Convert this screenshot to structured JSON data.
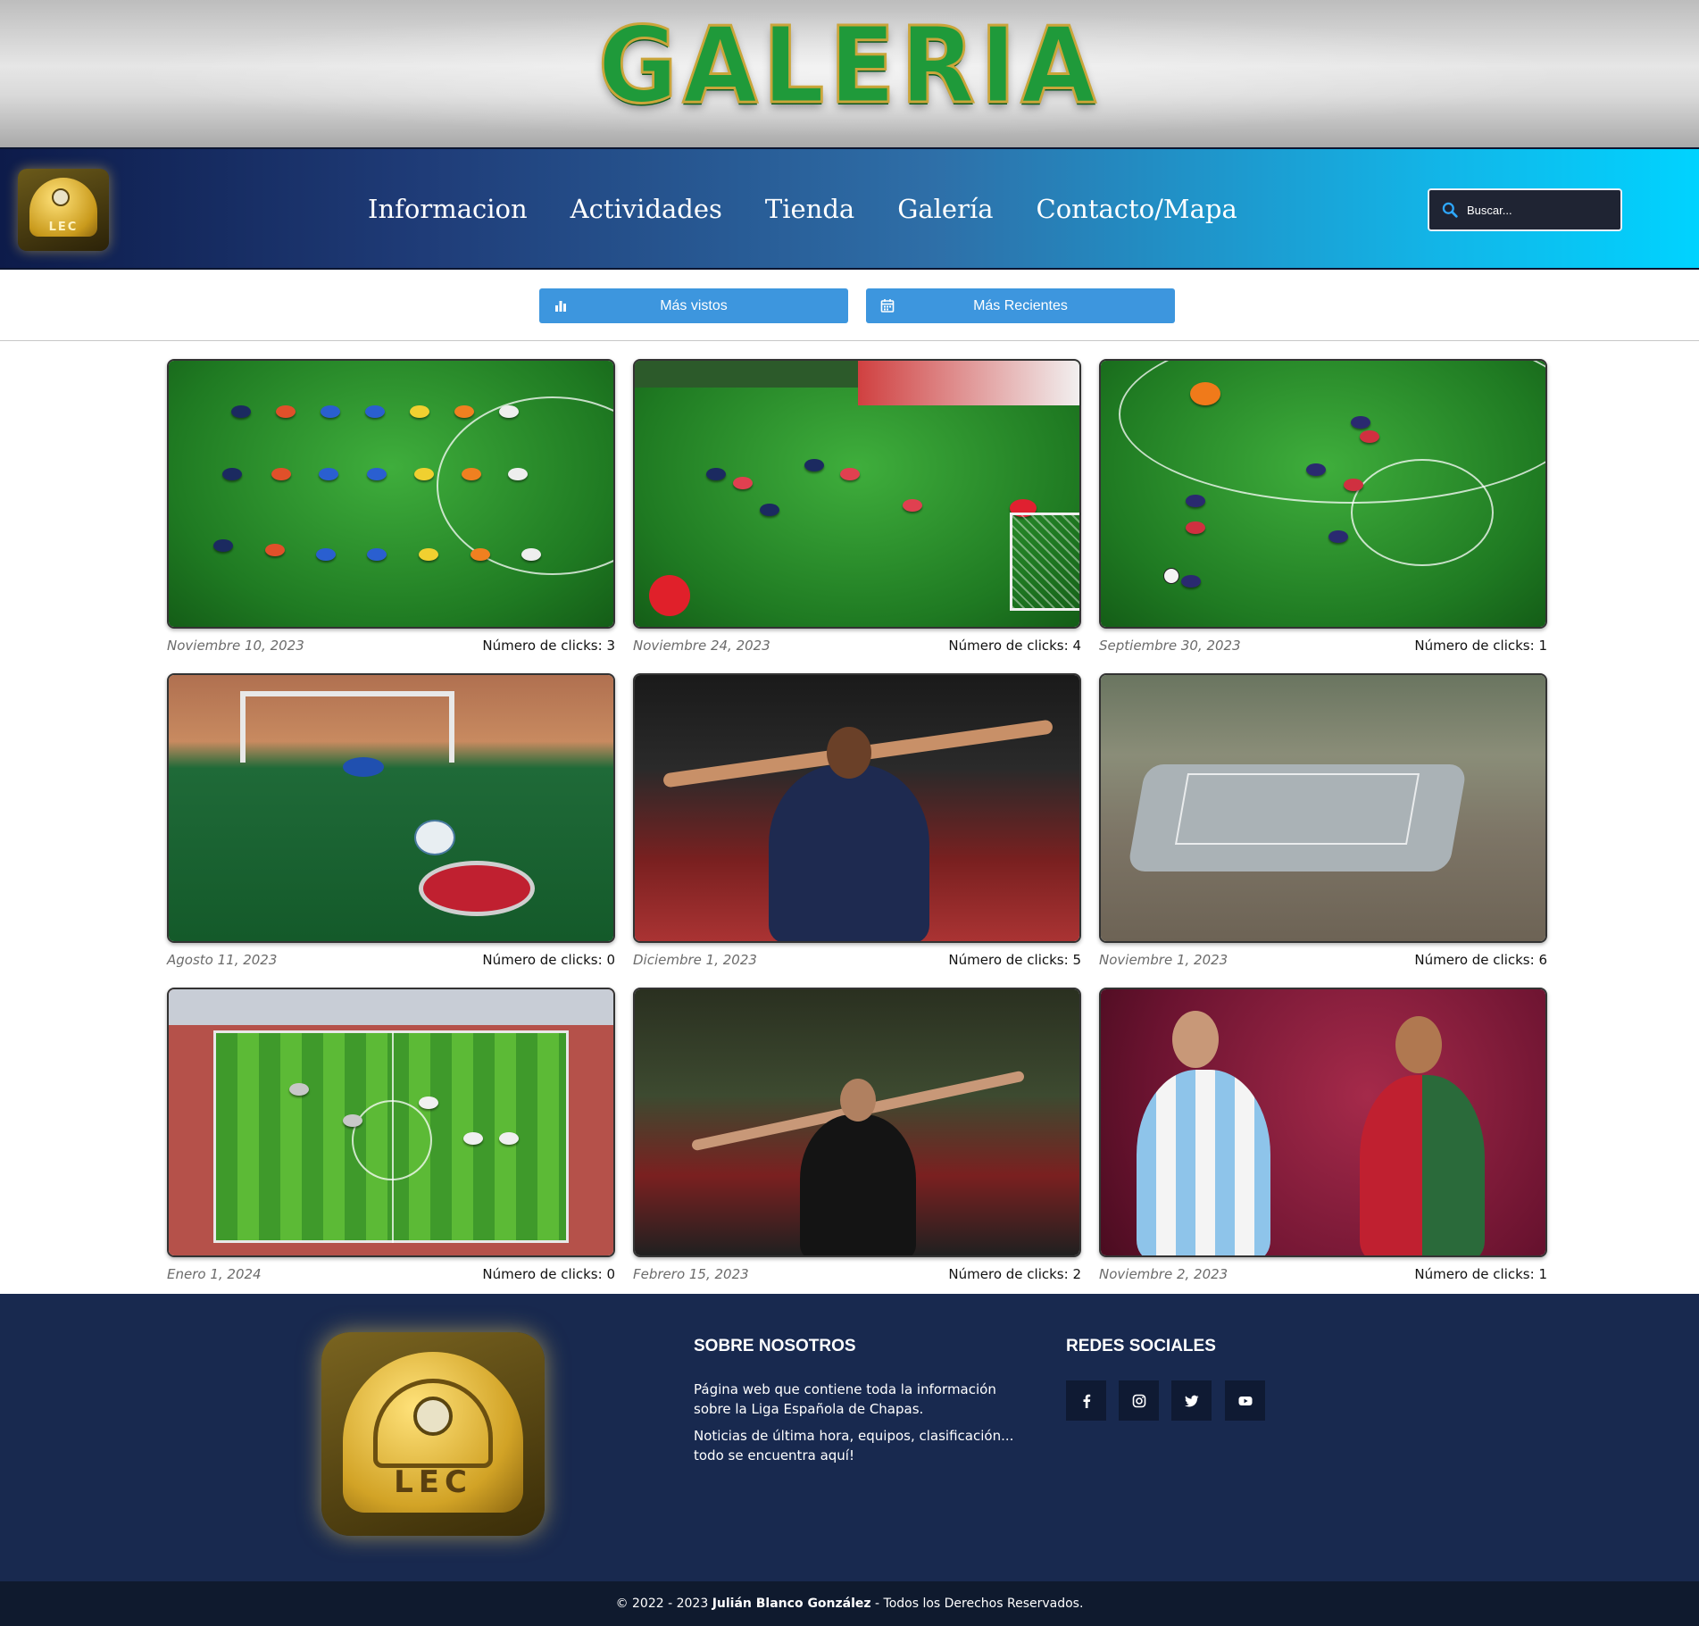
{
  "header": {
    "title": "GALERIA"
  },
  "nav": {
    "logo_text": "LEC",
    "links": [
      "Informacion",
      "Actividades",
      "Tienda",
      "Galería",
      "Contacto/Mapa"
    ],
    "search_placeholder": "Buscar..."
  },
  "filters": {
    "most_viewed": "Más vistos",
    "most_recent": "Más Recientes"
  },
  "gallery": [
    {
      "date": "Noviembre 10, 2023",
      "clicks": "Número de clicks: 3"
    },
    {
      "date": "Noviembre 24, 2023",
      "clicks": "Número de clicks: 4"
    },
    {
      "date": "Septiembre 30, 2023",
      "clicks": "Número de clicks: 1"
    },
    {
      "date": "Agosto 11, 2023",
      "clicks": "Número de clicks: 0"
    },
    {
      "date": "Diciembre 1, 2023",
      "clicks": "Número de clicks: 5"
    },
    {
      "date": "Noviembre 1, 2023",
      "clicks": "Número de clicks: 6"
    },
    {
      "date": "Enero 1, 2024",
      "clicks": "Número de clicks: 0"
    },
    {
      "date": "Febrero 15, 2023",
      "clicks": "Número de clicks: 2"
    },
    {
      "date": "Noviembre 2, 2023",
      "clicks": "Número de clicks: 1"
    }
  ],
  "footer": {
    "logo_text": "LEC",
    "about_heading": "SOBRE NOSOTROS",
    "about_text_1": "Página web que contiene toda la información sobre la Liga Española de Chapas.",
    "about_text_2": "Noticias de última hora, equipos, clasificación... todo se encuentra aquí!",
    "social_heading": "REDES SOCIALES",
    "social_icons": [
      "facebook-icon",
      "instagram-icon",
      "twitter-icon",
      "youtube-icon"
    ],
    "copyright_prefix": "© 2022 - 2023 ",
    "copyright_author": "Julián Blanco González",
    "copyright_suffix": " - Todos los Derechos Reservados."
  },
  "colors": {
    "nav_start": "#0d1b4a",
    "nav_end": "#00d3ff",
    "button": "#3d96de",
    "footer": "#18294f",
    "title_green": "#1f9a3a"
  }
}
